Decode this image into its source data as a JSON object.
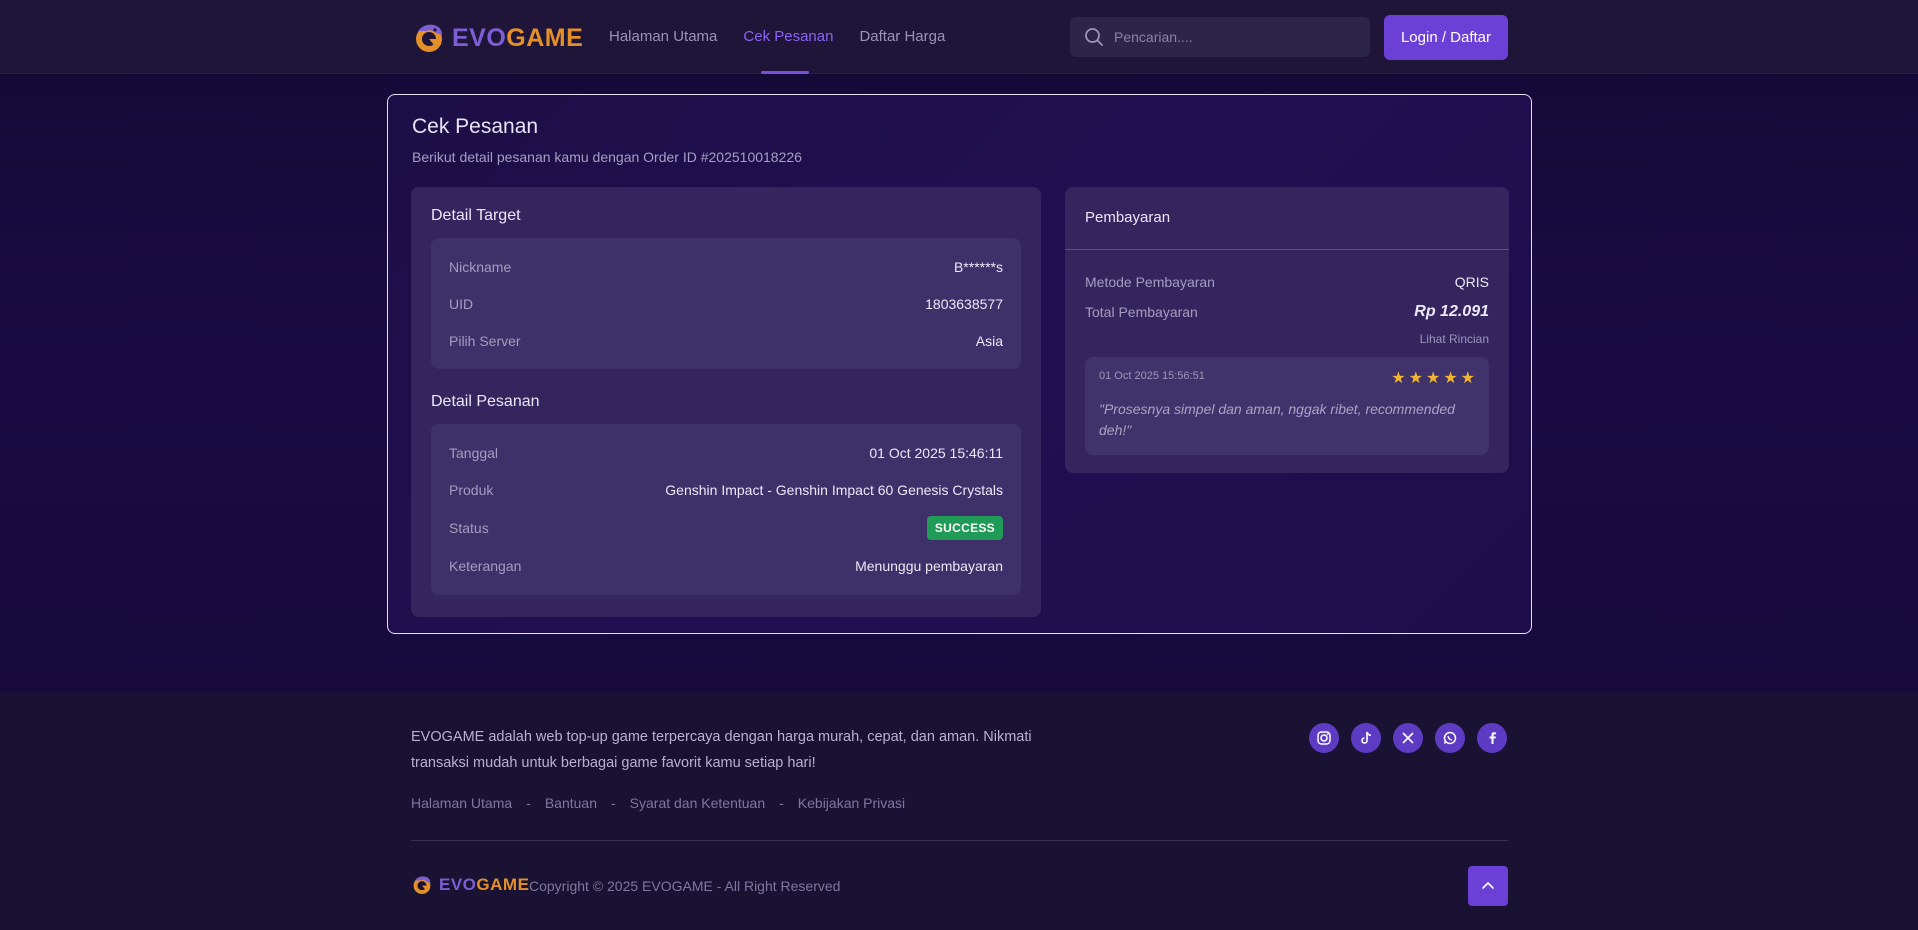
{
  "brand": {
    "evo": "EVO",
    "game": "GAME"
  },
  "nav": {
    "items": [
      {
        "label": "Halaman Utama"
      },
      {
        "label": "Cek Pesanan"
      },
      {
        "label": "Daftar Harga"
      }
    ]
  },
  "search": {
    "placeholder": "Pencarian...."
  },
  "login": {
    "label": "Login / Daftar"
  },
  "page": {
    "title": "Cek Pesanan",
    "subtitle": "Berikut detail pesanan kamu dengan Order ID #202510018226"
  },
  "detail_target": {
    "title": "Detail Target",
    "rows": [
      {
        "key": "Nickname",
        "value": "B******s"
      },
      {
        "key": "UID",
        "value": "1803638577"
      },
      {
        "key": "Pilih Server",
        "value": "Asia"
      }
    ]
  },
  "detail_pesanan": {
    "title": "Detail Pesanan",
    "tanggal_label": "Tanggal",
    "tanggal_value": "01 Oct 2025 15:46:11",
    "produk_label": "Produk",
    "produk_value": "Genshin Impact - Genshin Impact 60 Genesis Crystals",
    "status_label": "Status",
    "status_value": "SUCCESS",
    "keterangan_label": "Keterangan",
    "keterangan_value": "Menunggu pembayaran"
  },
  "pembayaran": {
    "title": "Pembayaran",
    "metode_label": "Metode Pembayaran",
    "metode_value": "QRIS",
    "total_label": "Total Pembayaran",
    "total_value": "Rp 12.091",
    "rincian": "Lihat Rincian"
  },
  "review": {
    "date": "01 Oct 2025 15:56:51",
    "rating": 5,
    "text": "\"Prosesnya simpel dan aman, nggak ribet, recommended deh!\""
  },
  "footer": {
    "description": "EVOGAME adalah web top-up game terpercaya dengan harga murah, cepat, dan aman. Nikmati transaksi mudah untuk berbagai game favorit kamu setiap hari!",
    "links": [
      "Halaman Utama",
      "Bantuan",
      "Syarat dan Ketentuan",
      "Kebijakan Privasi"
    ],
    "separator": "-",
    "copyright": "Copyright © 2025 EVOGAME - All Right Reserved"
  },
  "colors": {
    "accent": "#6c3fd6",
    "brand_purple": "#7c5fd4",
    "brand_orange": "#e3902a",
    "success": "#1f9a57",
    "star": "#f2b531"
  },
  "icons": {
    "search": "search-icon",
    "socials": [
      "instagram-icon",
      "tiktok-icon",
      "x-icon",
      "whatsapp-icon",
      "facebook-icon"
    ],
    "to_top": "chevron-up-icon"
  }
}
